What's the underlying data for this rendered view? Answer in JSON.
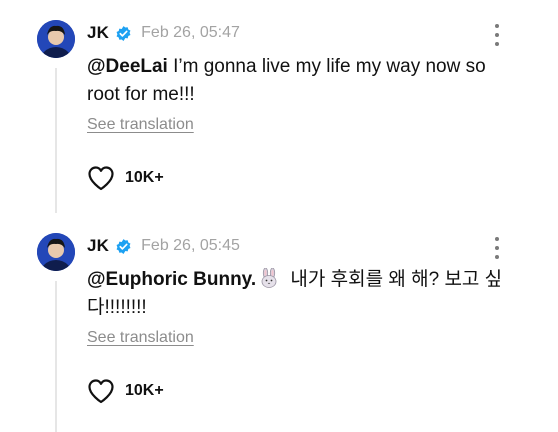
{
  "posts": [
    {
      "author": "JK",
      "timestamp": "Feb 26, 05:47",
      "mention": "@DeeLai",
      "text": " I’m gonna live my life my way now so root for me!!!",
      "translate_label": "See translation",
      "likes": "10K+",
      "has_emoji": false
    },
    {
      "author": "JK",
      "timestamp": "Feb 26, 05:45",
      "mention": "@Euphoric Bunny.",
      "text": " 내가 후회를 왜 해? 보고 싶다!!!!!!!!",
      "translate_label": "See translation",
      "likes": "10K+",
      "has_emoji": true,
      "emoji": "bunny-emoji"
    }
  ],
  "colors": {
    "verified": "#1da1f2",
    "timestamp": "#a3a3a3",
    "link_muted": "#8c8c8c",
    "thread_line": "#e6e6e6",
    "avatar_bg": "#1f3fa6"
  },
  "icons": {
    "verified": "verified-badge-icon",
    "more": "more-vertical-icon",
    "like": "heart-outline-icon"
  }
}
